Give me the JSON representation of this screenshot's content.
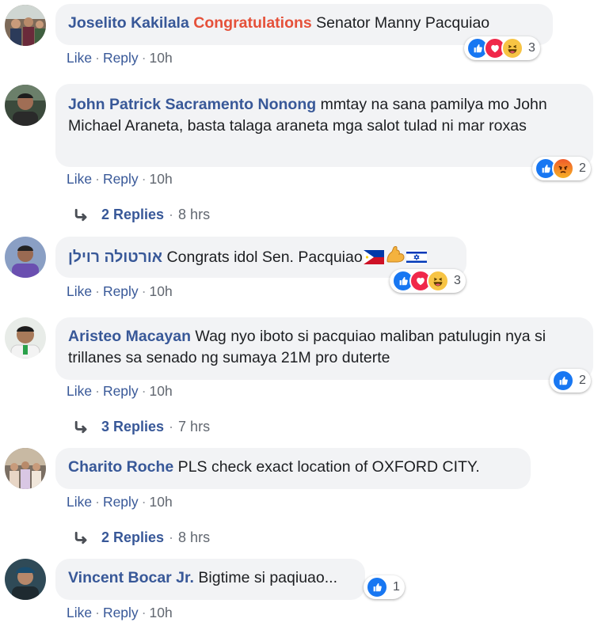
{
  "comments": [
    {
      "author": "Joselito Kakilala",
      "highlight": "Congratulations",
      "text": " Senator Manny Pacquiao",
      "like": "Like",
      "reply": "Reply",
      "time": "10h",
      "reaction_count": "3"
    },
    {
      "author": "John Patrick Sacramento Nonong",
      "text": " mmtay na sana pamilya mo John Michael Araneta, basta talaga araneta mga salot tulad ni mar roxas",
      "like": "Like",
      "reply": "Reply",
      "time": "10h",
      "reaction_count": "2",
      "replies": {
        "label": "2 Replies",
        "time": "8 hrs"
      }
    },
    {
      "author": "אורטולה רוילן",
      "text": " Congrats idol Sen. Pacquiao",
      "like": "Like",
      "reply": "Reply",
      "time": "10h",
      "reaction_count": "3"
    },
    {
      "author": "Aristeo Macayan",
      "text": " Wag nyo iboto si pacquiao maliban patulugin nya si trillanes sa senado ng sumaya 21M pro duterte",
      "like": "Like",
      "reply": "Reply",
      "time": "10h",
      "reaction_count": "2",
      "replies": {
        "label": "3 Replies",
        "time": "7 hrs"
      }
    },
    {
      "author": "Charito Roche",
      "text": " PLS check exact location of OXFORD CITY.",
      "like": "Like",
      "reply": "Reply",
      "time": "10h",
      "replies": {
        "label": "2 Replies",
        "time": "8 hrs"
      }
    },
    {
      "author": "Vincent Bocar Jr.",
      "text": " Bigtime si paqiuao...",
      "like": "Like",
      "reply": "Reply",
      "time": "10h",
      "reaction_count": "1"
    }
  ],
  "sep": "·"
}
